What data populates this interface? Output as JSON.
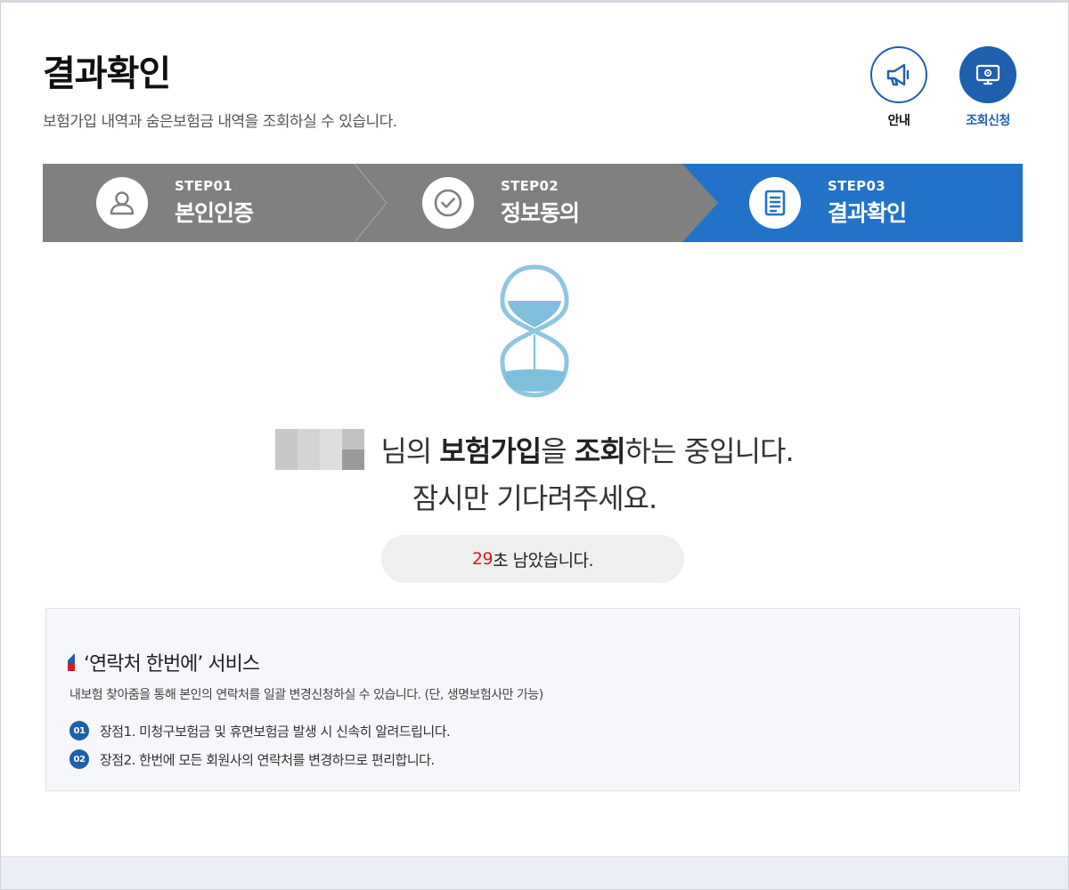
{
  "header": {
    "title": "결과확인",
    "description": "보험가입 내역과 숨은보험금 내역을 조회하실 수 있습니다."
  },
  "top_buttons": {
    "info_label": "안내",
    "apply_label": "조회신청"
  },
  "steps": [
    {
      "num": "STEP01",
      "name": "본인인증",
      "icon": "user-icon"
    },
    {
      "num": "STEP02",
      "name": "정보동의",
      "icon": "check-circle-icon"
    },
    {
      "num": "STEP03",
      "name": "결과확인",
      "icon": "document-icon"
    }
  ],
  "message": {
    "part1": "님의 ",
    "part2": "보험가입",
    "part3": "을 ",
    "part4": "조회",
    "part5": "하는 중입니다.",
    "line2": "잠시만 기다려주세요."
  },
  "timer": {
    "seconds": "29",
    "suffix": "초 남았습니다."
  },
  "service": {
    "title": "‘연락처 한번에’ 서비스",
    "description": "내보험 찾아줌을 통해 본인의 연락처를 일괄 변경신청하실 수 있습니다. (단, 생명보험사만 가능)",
    "points": [
      {
        "num": "01",
        "text": "장점1. 미청구보험금 및 휴면보험금 발생 시 신속히 알려드립니다."
      },
      {
        "num": "02",
        "text": "장점2. 한번에 모든 회원사의 연락처를 변경하므로 편리합니다."
      }
    ]
  },
  "colors": {
    "active_step": "#2272c9",
    "inactive_step": "#808080",
    "brand_blue": "#1e5fae",
    "timer_red": "#d7191e",
    "hourglass_sand": "#7fbfdc"
  }
}
